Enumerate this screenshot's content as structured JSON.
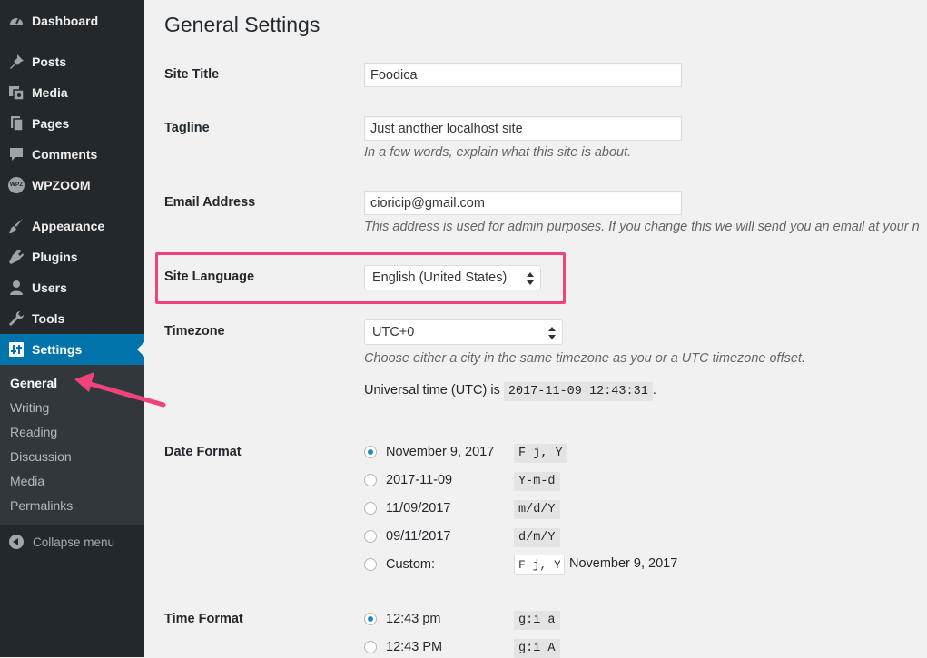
{
  "sidebar": {
    "items": [
      {
        "label": "Dashboard",
        "icon": "dashboard-icon"
      },
      {
        "label": "Posts",
        "icon": "pin-icon"
      },
      {
        "label": "Media",
        "icon": "media-icon"
      },
      {
        "label": "Pages",
        "icon": "pages-icon"
      },
      {
        "label": "Comments",
        "icon": "comments-icon"
      },
      {
        "label": "WPZOOM",
        "icon": "wpzoom-icon",
        "icon_text": "WPZ"
      },
      {
        "label": "Appearance",
        "icon": "paintbrush-icon"
      },
      {
        "label": "Plugins",
        "icon": "plugin-icon"
      },
      {
        "label": "Users",
        "icon": "user-icon"
      },
      {
        "label": "Tools",
        "icon": "wrench-icon"
      },
      {
        "label": "Settings",
        "icon": "settings-icon",
        "active": true
      }
    ],
    "submenu": [
      "General",
      "Writing",
      "Reading",
      "Discussion",
      "Media",
      "Permalinks"
    ],
    "current_submenu": "General",
    "collapse_label": "Collapse menu"
  },
  "page": {
    "title": "General Settings"
  },
  "fields": {
    "site_title": {
      "label": "Site Title",
      "value": "Foodica"
    },
    "tagline": {
      "label": "Tagline",
      "value": "Just another localhost site",
      "description": "In a few words, explain what this site is about."
    },
    "email": {
      "label": "Email Address",
      "value": "cioricip@gmail.com",
      "description": "This address is used for admin purposes. If you change this we will send you an email at your n"
    },
    "site_language": {
      "label": "Site Language",
      "value": "English (United States)"
    },
    "timezone": {
      "label": "Timezone",
      "value": "UTC+0",
      "description": "Choose either a city in the same timezone as you or a UTC timezone offset.",
      "utc_prefix": "Universal time (UTC) is",
      "utc_time": "2017-11-09 12:43:31",
      "utc_suffix": "."
    },
    "date_format": {
      "label": "Date Format",
      "options": [
        {
          "label": "November 9, 2017",
          "format": "F j, Y",
          "checked": true
        },
        {
          "label": "2017-11-09",
          "format": "Y-m-d",
          "checked": false
        },
        {
          "label": "11/09/2017",
          "format": "m/d/Y",
          "checked": false
        },
        {
          "label": "09/11/2017",
          "format": "d/m/Y",
          "checked": false
        }
      ],
      "custom_label": "Custom:",
      "custom_value": "F j, Y",
      "custom_preview": "November 9, 2017"
    },
    "time_format": {
      "label": "Time Format",
      "options": [
        {
          "label": "12:43 pm",
          "format": "g:i a",
          "checked": true
        },
        {
          "label": "12:43 PM",
          "format": "g:i A",
          "checked": false
        }
      ]
    }
  },
  "colors": {
    "sidebar_bg": "#23282d",
    "submenu_bg": "#32373c",
    "active_blue": "#0073aa",
    "annotation_pink": "#f0437c"
  }
}
